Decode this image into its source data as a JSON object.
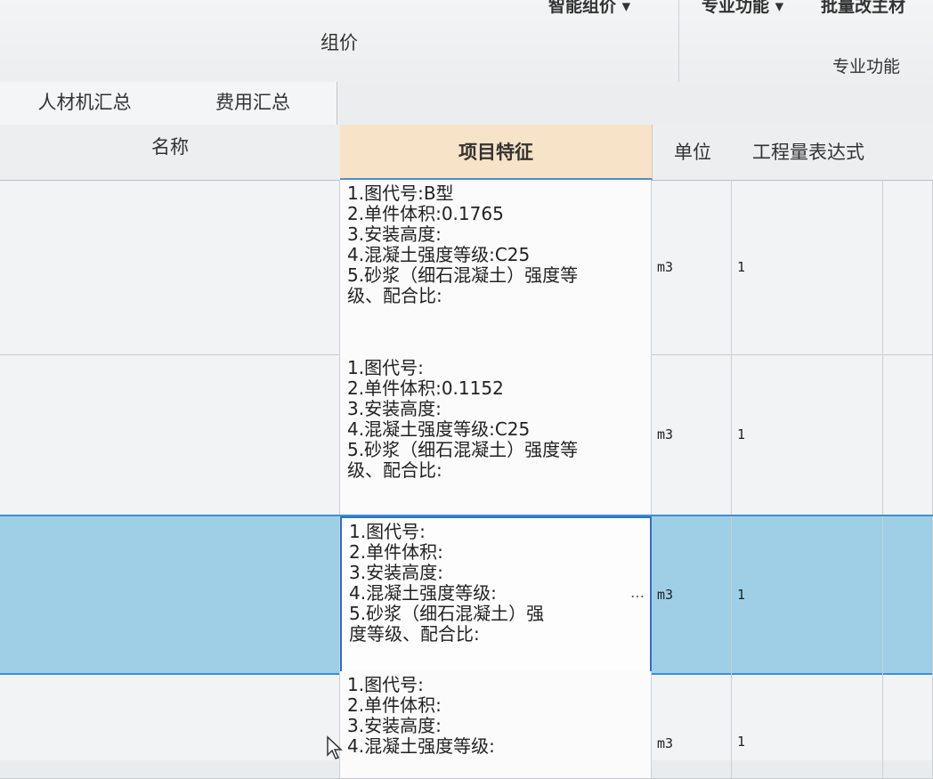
{
  "ribbon": {
    "top_items": [
      "智能组价 ▾",
      "专业功能 ▾",
      "批量改主材"
    ],
    "group_pricing": "组价",
    "group_professional": "专业功能"
  },
  "tabs": [
    "人材机汇总",
    "费用汇总"
  ],
  "columns": {
    "name": "名称",
    "feature": "项目特征",
    "unit": "单位",
    "expr": "工程量表达式"
  },
  "rows": [
    {
      "feature_lines": [
        "1.图代号:B型",
        "2.单件体积:0.1765",
        "3.安装高度:",
        "4.混凝土强度等级:C25",
        "5.砂浆（细石混凝土）强度等",
        "级、配合比:"
      ],
      "unit": "m3",
      "expr": "1"
    },
    {
      "feature_lines": [
        "1.图代号:",
        "2.单件体积:0.1152",
        "3.安装高度:",
        "4.混凝土强度等级:C25",
        "5.砂浆（细石混凝土）强度等",
        "级、配合比:"
      ],
      "unit": "m3",
      "expr": "1"
    },
    {
      "feature_lines": [
        "1.图代号:",
        "2.单件体积:",
        "3.安装高度:",
        "4.混凝土强度等级:",
        "5.砂浆（细石混凝土）强",
        "度等级、配合比:"
      ],
      "unit": "m3",
      "expr": "1",
      "selected": true,
      "ellipsis": "…"
    },
    {
      "feature_lines": [
        "1.图代号:",
        "2.单件体积:",
        "3.安装高度:",
        "4.混凝土强度等级:"
      ],
      "unit": "m3",
      "expr": "1"
    }
  ],
  "colors": {
    "selected_row": "#9ecfe6",
    "selected_border": "#3b8fd6",
    "feature_header": "#f7e3c7"
  }
}
